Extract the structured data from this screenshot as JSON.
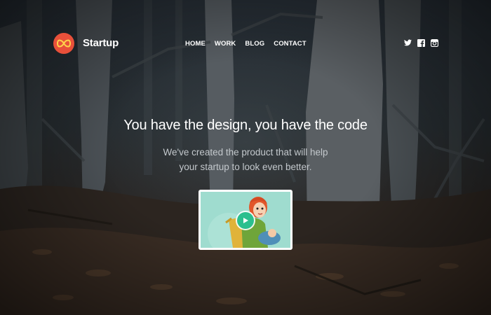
{
  "brand": {
    "name": "Startup",
    "logo_icon": "infinity-icon",
    "accent": "#e8503a"
  },
  "nav": {
    "items": [
      {
        "label": "HOME"
      },
      {
        "label": "WORK"
      },
      {
        "label": "BLOG"
      },
      {
        "label": "CONTACT"
      }
    ]
  },
  "social": {
    "icons": [
      "twitter-icon",
      "facebook-icon",
      "instagram-icon"
    ]
  },
  "hero": {
    "headline": "You have the design, you have the code",
    "subline_1": "We've created the product that will help",
    "subline_2": "your startup to look even better."
  },
  "video": {
    "play_icon": "play-icon",
    "play_color": "#2bbf8e"
  }
}
